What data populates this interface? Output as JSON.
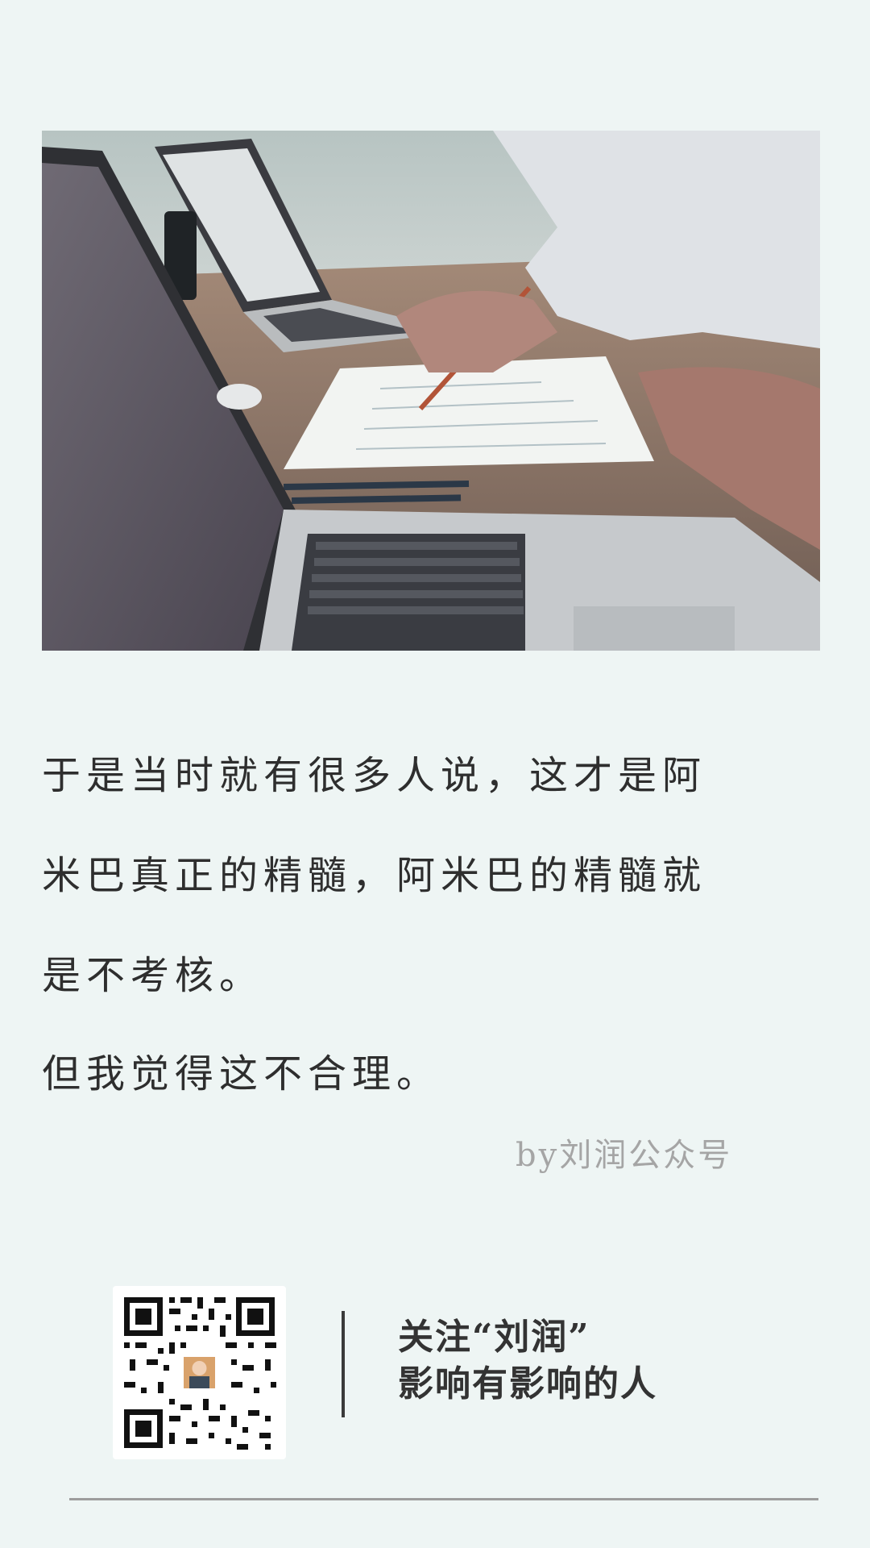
{
  "article": {
    "paragraph1": {
      "line1": "于是当时就有很多人说，这才是阿",
      "line2": "米巴真正的精髓，阿米巴的精髓就",
      "line3": "是不考核。"
    },
    "paragraph2": "但我觉得这不合理。",
    "byline": "by刘润公众号"
  },
  "footer": {
    "follow_line": "关注“刘润”",
    "slogan": "影响有影响的人"
  },
  "colors": {
    "background": "#eef5f4",
    "text": "#2e2e2e",
    "byline": "#a5a5a5",
    "divider": "#3a3a3a"
  },
  "icons": {
    "photo": "office-laptops-photo",
    "qr": "wechat-qr-code"
  }
}
